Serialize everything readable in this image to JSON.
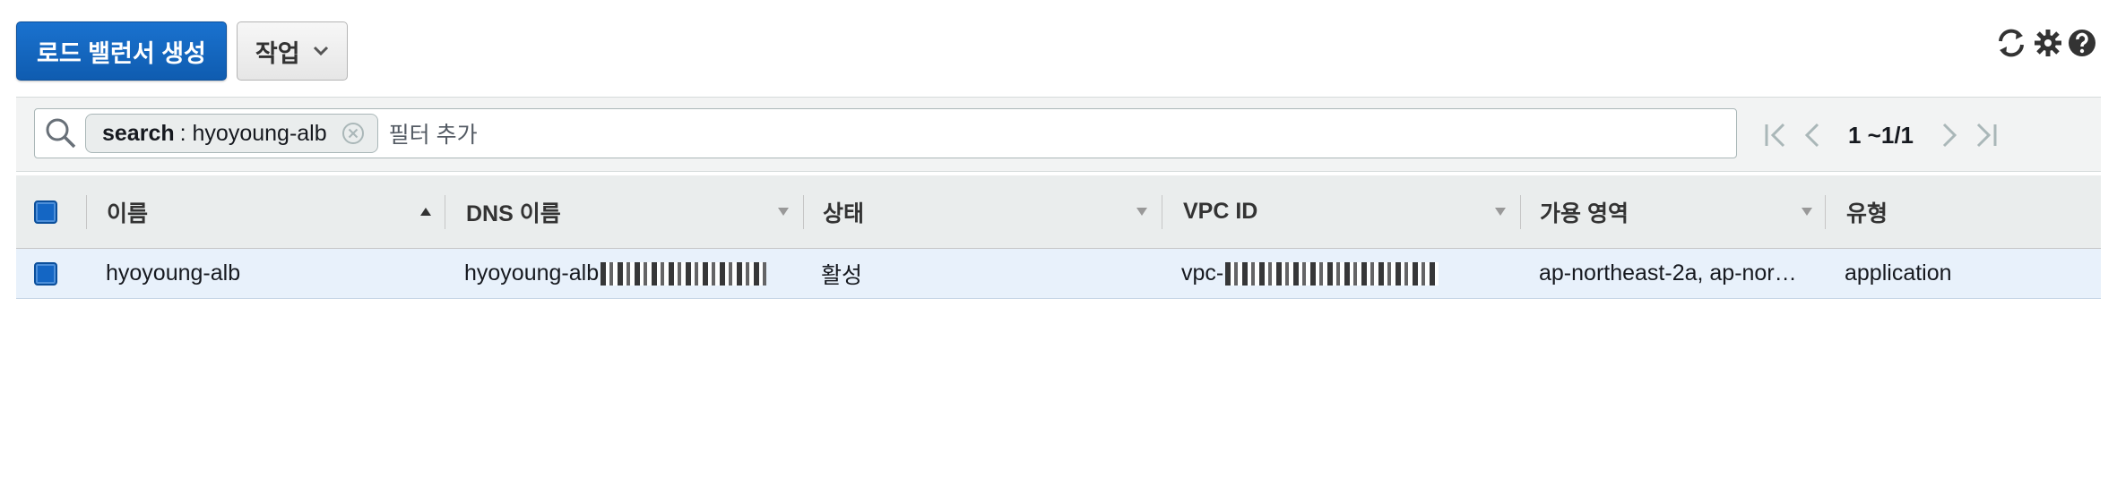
{
  "toolbar": {
    "create_label": "로드 밸런서 생성",
    "actions_label": "작업"
  },
  "top_icons": [
    "refresh-icon",
    "gear-icon",
    "help-icon"
  ],
  "filter": {
    "token_key": "search",
    "token_value": ": hyoyoung-alb",
    "placeholder": "필터 추가"
  },
  "pager": {
    "range": "1 ~1/1"
  },
  "table": {
    "columns": [
      "이름",
      "DNS 이름",
      "상태",
      "VPC ID",
      "가용 영역",
      "유형"
    ],
    "rows": [
      {
        "name": "hyoyoung-alb",
        "dns_prefix": "hyoyoung-alb",
        "status": "활성",
        "vpc_prefix": "vpc-",
        "az": "ap-northeast-2a, ap-nor…",
        "type": "application"
      }
    ]
  },
  "colors": {
    "primary_button": "#0f5cb0",
    "row_selected": "#e8f1fb",
    "header_bg": "#eaeded"
  }
}
